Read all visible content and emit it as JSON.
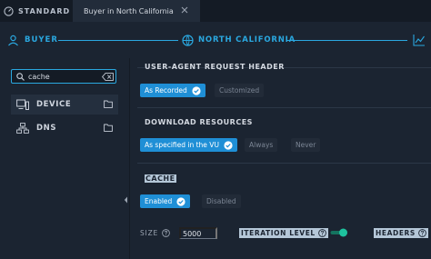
{
  "tabs": {
    "standard_label": "STANDARD",
    "active_tab_label": "Buyer in North California"
  },
  "stepper": {
    "step1": "BUYER",
    "step2": "NORTH CALIFORNIA"
  },
  "sidebar": {
    "search_value": "cache",
    "items": [
      {
        "label": "DEVICE"
      },
      {
        "label": "DNS"
      }
    ]
  },
  "sections": {
    "user_agent": {
      "title": "USER-AGENT REQUEST HEADER",
      "options": [
        "As Recorded",
        "Customized"
      ]
    },
    "download": {
      "title": "DOWNLOAD RESOURCES",
      "options": [
        "As specified in the VU",
        "Always",
        "Never"
      ]
    },
    "cache": {
      "title": "CACHE",
      "options": [
        "Enabled",
        "Disabled"
      ],
      "size_label": "SIZE",
      "size_value": "5000",
      "iteration_label": "ITERATION LEVEL",
      "headers_label": "HEADERS"
    }
  },
  "colors": {
    "accent": "#2aa8e0",
    "button_on": "#1f8fd6",
    "toggle_on": "#1ec29e"
  }
}
